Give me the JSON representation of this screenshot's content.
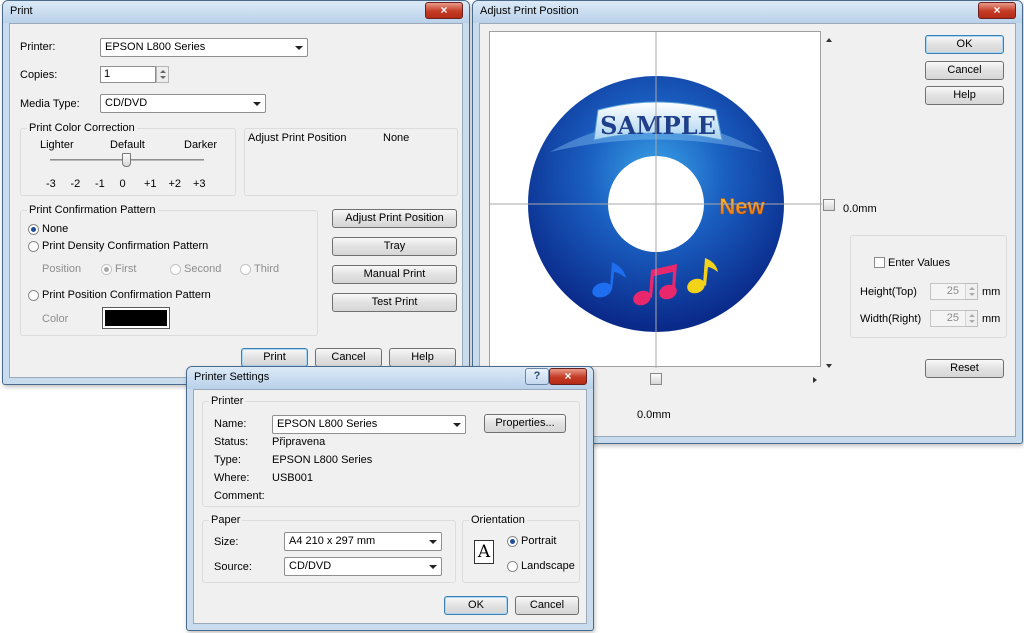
{
  "print_dialog": {
    "title": "Print",
    "printer_label": "Printer:",
    "printer_value": "EPSON L800 Series",
    "copies_label": "Copies:",
    "copies_value": "1",
    "media_type_label": "Media Type:",
    "media_type_value": "CD/DVD",
    "color_correction": {
      "title": "Print Color Correction",
      "lighter": "Lighter",
      "default": "Default",
      "darker": "Darker",
      "scale": [
        "-3",
        "-2",
        "-1",
        "0",
        "+1",
        "+2",
        "+3"
      ],
      "slider_value": 0
    },
    "adjust_summary": {
      "label": "Adjust Print Position",
      "value": "None"
    },
    "confirmation": {
      "title": "Print Confirmation Pattern",
      "none": "None",
      "density": "Print Density Confirmation Pattern",
      "position_label": "Position",
      "first": "First",
      "second": "Second",
      "third": "Third",
      "position_pattern": "Print Position Confirmation Pattern",
      "color_label": "Color",
      "color_swatch": "#000000"
    },
    "buttons": {
      "adjust": "Adjust Print Position",
      "tray": "Tray",
      "manual": "Manual Print",
      "test": "Test Print",
      "print": "Print",
      "cancel": "Cancel",
      "help": "Help"
    }
  },
  "adjust_dialog": {
    "title": "Adjust Print Position",
    "disc_title_text": "SAMPLE",
    "disc_new_text": "New",
    "vertical_offset": "0.0mm",
    "horizontal_offset": "0.0mm",
    "buttons": {
      "ok": "OK",
      "cancel": "Cancel",
      "help": "Help",
      "reset": "Reset"
    },
    "enter_values_label": "Enter Values",
    "height_label": "Height(Top)",
    "height_value": "25",
    "width_label": "Width(Right)",
    "width_value": "25",
    "unit": "mm"
  },
  "printer_settings": {
    "title": "Printer Settings",
    "help_glyph": "?",
    "printer_group": "Printer",
    "name_label": "Name:",
    "name_value": "EPSON L800 Series",
    "properties_button": "Properties...",
    "status_label": "Status:",
    "status_value": "Připravena",
    "type_label": "Type:",
    "type_value": "EPSON L800 Series",
    "where_label": "Where:",
    "where_value": "USB001",
    "comment_label": "Comment:",
    "paper_group": "Paper",
    "size_label": "Size:",
    "size_value": "A4 210 x 297 mm",
    "source_label": "Source:",
    "source_value": "CD/DVD",
    "orientation_group": "Orientation",
    "orientation_glyph": "A",
    "portrait": "Portrait",
    "landscape": "Landscape",
    "ok": "OK",
    "cancel": "Cancel"
  },
  "colors": {
    "disc_dark": "#0a2a8a",
    "disc_light": "#1e78d0",
    "sample_text": "#1f3f8a",
    "new_text": "#e7a21a"
  }
}
